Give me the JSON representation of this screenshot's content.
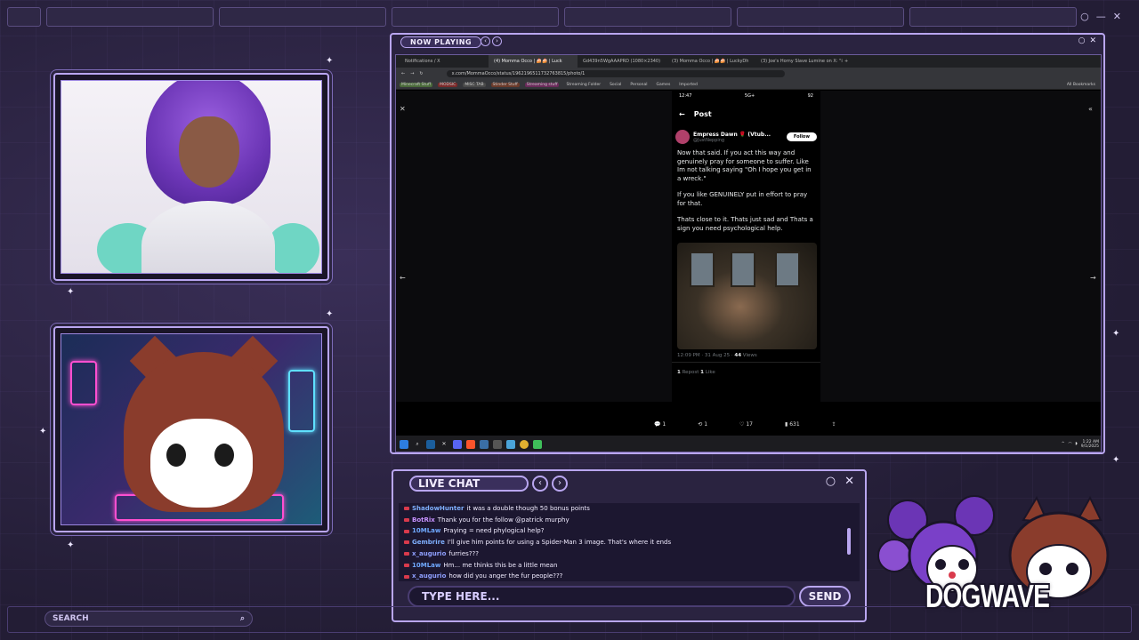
{
  "now_playing": {
    "label": "NOW PLAYING"
  },
  "browser": {
    "tabs": [
      "Notifications / X",
      "(4) Momma Occo | 🍰🍰 | Luck",
      "Gd439n5WgAAAPRD (1080×2340)",
      "(3) Momma Occo | 🍰🍰 | LuckyDh",
      "(3) Joe's Horny Slave Lumine on X: \"i"
    ],
    "url": "x.com/MommaOcco/status/1962196511732763815/photo/1",
    "bookmarks": [
      "Minecraft Stuff",
      "MODSIC",
      "MISC TAB",
      "Stinder Stuff",
      "Streaming stuff",
      "Streaming Folder",
      "Social",
      "Personal",
      "Games",
      "Imported",
      "All Bookmarks"
    ]
  },
  "post": {
    "status_time": "12:47",
    "status_right": "5G+",
    "battery": "92",
    "header": "Post",
    "author": "Empress Dawn 🌹 (Vtub...",
    "handle": "@JustNepping",
    "follow": "Follow",
    "paragraphs": [
      "Now that said. If you act this way and genuinely pray for someone to suffer. Like Im not talking saying \"Oh I hope you get in a wreck.\"",
      "If you like GENUINELY put in effort to pray for that.",
      "Thats close to it. Thats just sad and Thats a sign you need psychological help."
    ],
    "time": "12:09 PM · 31 Aug 25 ·",
    "views": "44",
    "views_label": "Views",
    "reposts": "1",
    "reposts_label": "Repost",
    "likes": "1",
    "likes_label": "Like"
  },
  "photo_actions": {
    "replies": "1",
    "reposts": "1",
    "likes": "17",
    "views": "631"
  },
  "taskbar": {
    "time": "1:22 AM",
    "date": "9/1/2025"
  },
  "chat": {
    "label": "LIVE CHAT",
    "messages": [
      {
        "user": "ShadowHunter",
        "text": "it was a double though 50 bonus points",
        "color": "#7fb0ff"
      },
      {
        "user": "BotRix",
        "text": "Thank you for the follow @patrick murphy",
        "color": "#c792ff"
      },
      {
        "user": "10MLaw",
        "text": "Praying = need phylogical help?",
        "color": "#6fa8ff"
      },
      {
        "user": "Gembrire",
        "text": "I'll give him points for using a Spider-Man 3 image. That's where it ends",
        "color": "#7fb0ff"
      },
      {
        "user": "x_augurio",
        "text": "furries???",
        "color": "#8fa0ff"
      },
      {
        "user": "10MLaw",
        "text": "Hm... me thinks this be a little mean",
        "color": "#6fa8ff"
      },
      {
        "user": "x_augurio",
        "text": "how did you anger the fur people???",
        "color": "#8fa0ff"
      }
    ],
    "placeholder": "TYPE HERE...",
    "send": "SEND"
  },
  "search": {
    "placeholder": "SEARCH"
  },
  "logo": {
    "text": "DOGWAVE"
  },
  "colors": {
    "accent": "#b9a6f0",
    "bg": "#2b2440",
    "panel": "#1c1730"
  }
}
